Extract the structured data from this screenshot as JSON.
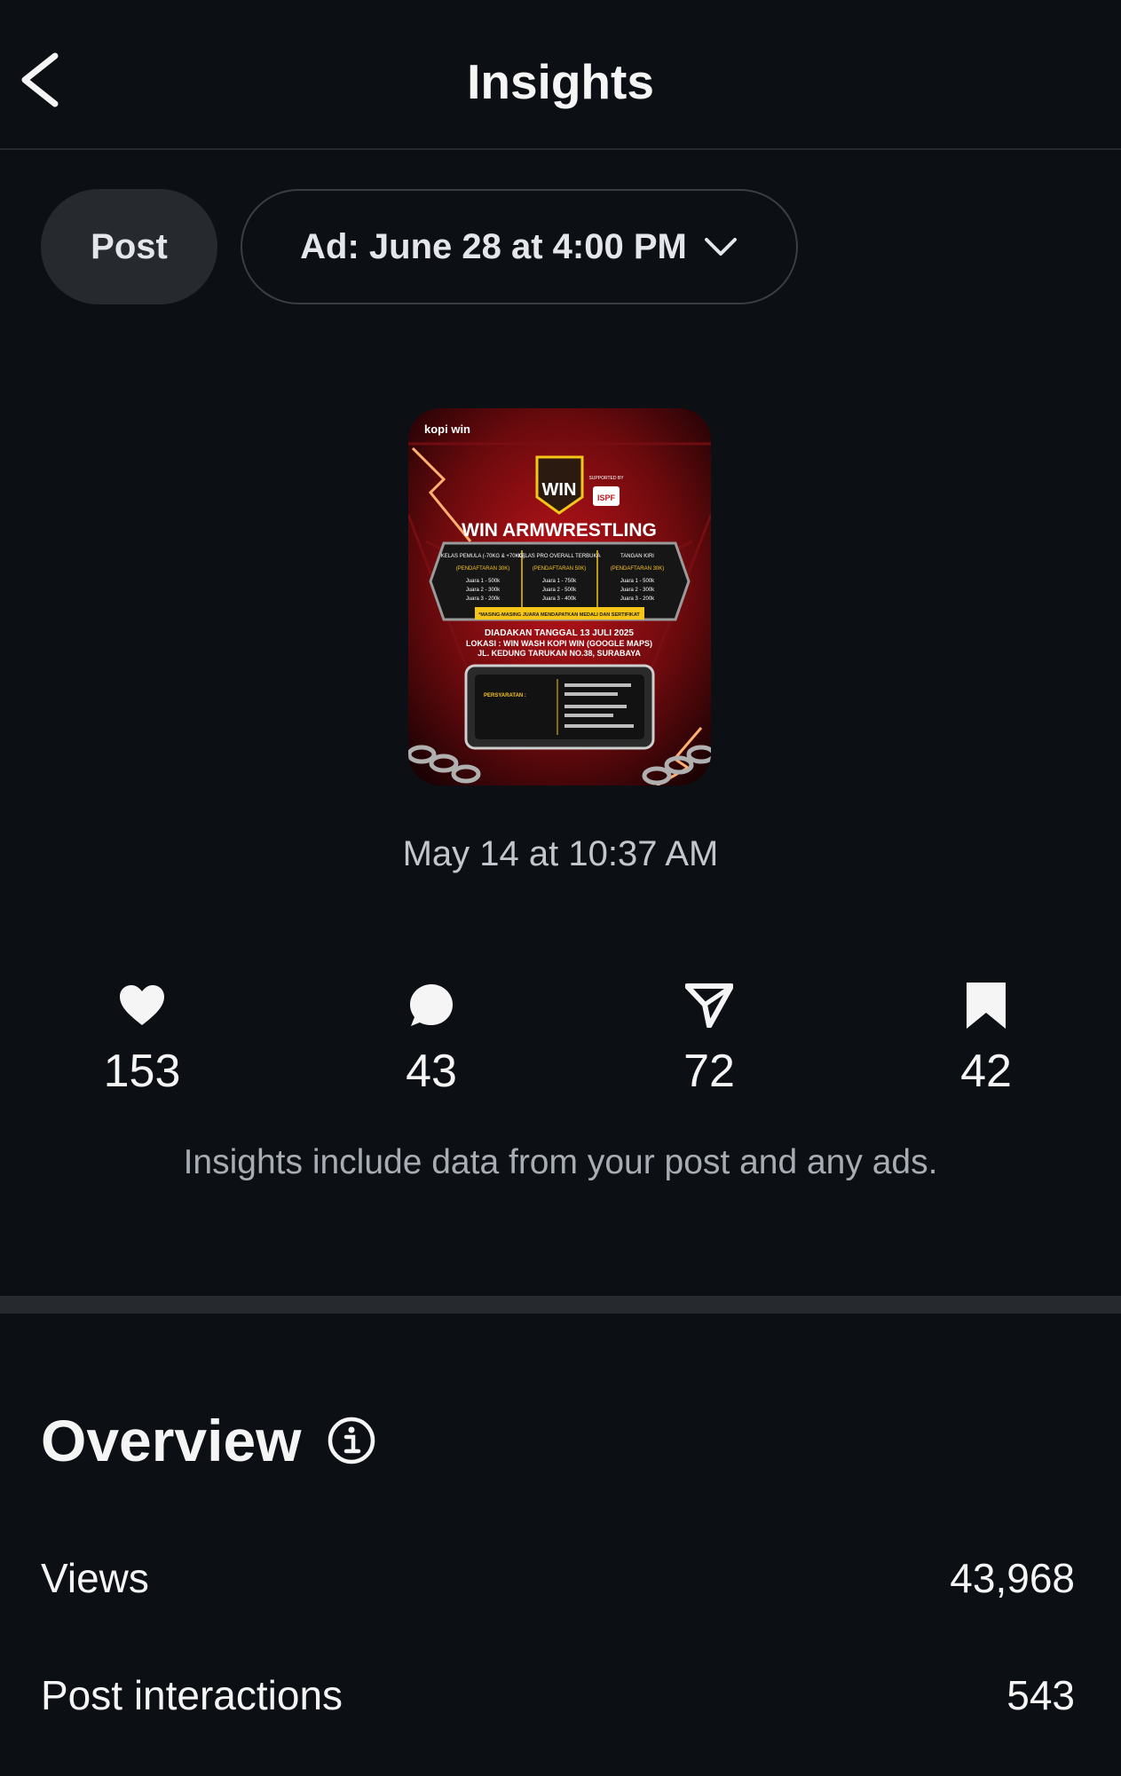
{
  "header": {
    "title": "Insights",
    "back_icon": "chevron-left-icon"
  },
  "filters": {
    "post_label": "Post",
    "ad_label": "Ad: June 28 at 4:00 PM",
    "ad_dropdown_icon": "chevron-down-icon"
  },
  "post": {
    "thumbnail": {
      "brand": "kopi win",
      "supported_by": "SUPPORTED BY",
      "headline": "WIN ARMWRESTLING",
      "columns": [
        {
          "title": "KELAS PEMULA (-70KG & +70KG)",
          "fee": "(PENDAFTARAN 30K)",
          "prizes": [
            "Juara 1 - 500k",
            "Juara 2 - 300k",
            "Juara 3 - 200k"
          ]
        },
        {
          "title": "KELAS PRO OVERALL TERBUKA",
          "fee": "(PENDAFTARAN 50K)",
          "prizes": [
            "Juara 1 - 750k",
            "Juara 2 - 500k",
            "Juara 3 - 400k"
          ]
        },
        {
          "title": "TANGAN KIRI",
          "fee": "(PENDAFTARAN 30K)",
          "prizes": [
            "Juara 1 - 500k",
            "Juara 2 - 300k",
            "Juara 3 - 200k"
          ]
        }
      ],
      "banner": "*MASING-MASING JUARA MENDAPATKAN MEDALI DAN SERTIFIKAT",
      "date_line": "DIADAKAN TANGGAL 13 JULI 2025",
      "location_line": "LOKASI : WIN WASH KOPI WIN (GOOGLE MAPS)",
      "address_line": "JL. KEDUNG TARUKAN NO.38, SURABAYA",
      "requirements": "PERSYARATAN :"
    },
    "date": "May 14 at 10:37 AM"
  },
  "stats": [
    {
      "icon": "heart-icon",
      "value": "153"
    },
    {
      "icon": "comment-icon",
      "value": "43"
    },
    {
      "icon": "share-icon",
      "value": "72"
    },
    {
      "icon": "bookmark-icon",
      "value": "42"
    }
  ],
  "note": "Insights include data from your post and any ads.",
  "overview": {
    "title": "Overview",
    "info_icon": "info-icon",
    "rows": [
      {
        "label": "Views",
        "value": "43,968"
      },
      {
        "label": "Post interactions",
        "value": "543"
      }
    ]
  },
  "colors": {
    "background": "#0c1014",
    "chip": "#262a2f",
    "muted_text": "#a8adb4",
    "poster_red": "#c0141a",
    "poster_yellow": "#f5c518"
  }
}
